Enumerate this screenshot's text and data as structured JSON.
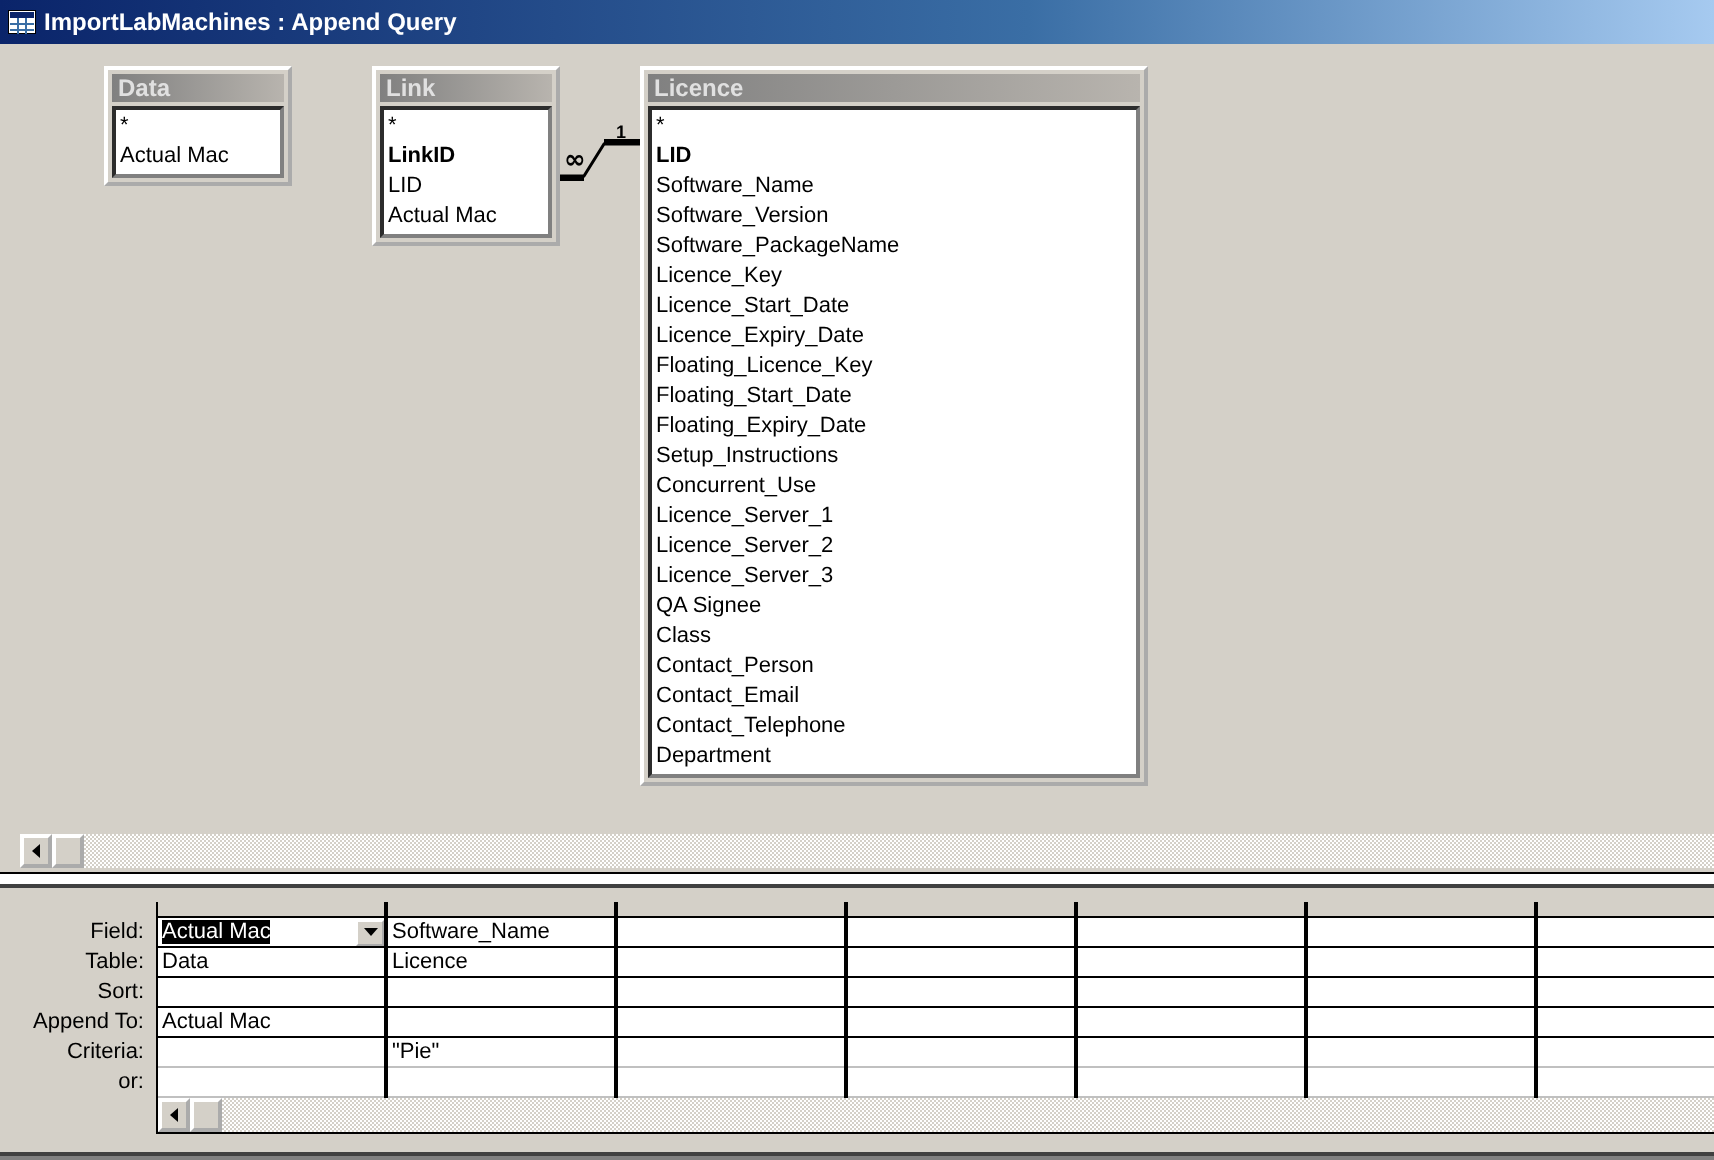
{
  "window": {
    "title": "ImportLabMachines : Append Query"
  },
  "tables": [
    {
      "name": "Data",
      "fields": [
        {
          "name": "*",
          "primary_key": false
        },
        {
          "name": "Actual Mac",
          "primary_key": false
        }
      ]
    },
    {
      "name": "Link",
      "fields": [
        {
          "name": "*",
          "primary_key": false
        },
        {
          "name": "LinkID",
          "primary_key": true
        },
        {
          "name": "LID",
          "primary_key": false
        },
        {
          "name": "Actual Mac",
          "primary_key": false
        }
      ]
    },
    {
      "name": "Licence",
      "fields": [
        {
          "name": "*",
          "primary_key": false
        },
        {
          "name": "LID",
          "primary_key": true
        },
        {
          "name": "Software_Name",
          "primary_key": false
        },
        {
          "name": "Software_Version",
          "primary_key": false
        },
        {
          "name": "Software_PackageName",
          "primary_key": false
        },
        {
          "name": "Licence_Key",
          "primary_key": false
        },
        {
          "name": "Licence_Start_Date",
          "primary_key": false
        },
        {
          "name": "Licence_Expiry_Date",
          "primary_key": false
        },
        {
          "name": "Floating_Licence_Key",
          "primary_key": false
        },
        {
          "name": "Floating_Start_Date",
          "primary_key": false
        },
        {
          "name": "Floating_Expiry_Date",
          "primary_key": false
        },
        {
          "name": "Setup_Instructions",
          "primary_key": false
        },
        {
          "name": "Concurrent_Use",
          "primary_key": false
        },
        {
          "name": "Licence_Server_1",
          "primary_key": false
        },
        {
          "name": "Licence_Server_2",
          "primary_key": false
        },
        {
          "name": "Licence_Server_3",
          "primary_key": false
        },
        {
          "name": "QA Signee",
          "primary_key": false
        },
        {
          "name": "Class",
          "primary_key": false
        },
        {
          "name": "Contact_Person",
          "primary_key": false
        },
        {
          "name": "Contact_Email",
          "primary_key": false
        },
        {
          "name": "Contact_Telephone",
          "primary_key": false
        },
        {
          "name": "Department",
          "primary_key": false
        }
      ]
    }
  ],
  "relationship": {
    "many_label": "∞",
    "one_label": "1"
  },
  "grid": {
    "row_labels": [
      {
        "label": "Field:",
        "kind": "field"
      },
      {
        "label": "Table:",
        "kind": "table"
      },
      {
        "label": "Sort:",
        "kind": "sort"
      },
      {
        "label": "Append To:",
        "kind": "append_to"
      },
      {
        "label": "Criteria:",
        "kind": "criteria"
      },
      {
        "label": "or:",
        "kind": "or"
      }
    ],
    "columns": [
      {
        "field": "Actual Mac",
        "table": "Data",
        "append_to": "Actual Mac",
        "selected": true
      },
      {
        "field": "Software_Name",
        "table": "Licence",
        "criteria": "\"Pie\"",
        "selected": false
      },
      {
        "selected": false
      },
      {
        "selected": false
      },
      {
        "selected": false
      },
      {
        "selected": false
      },
      {
        "selected": false
      }
    ]
  }
}
